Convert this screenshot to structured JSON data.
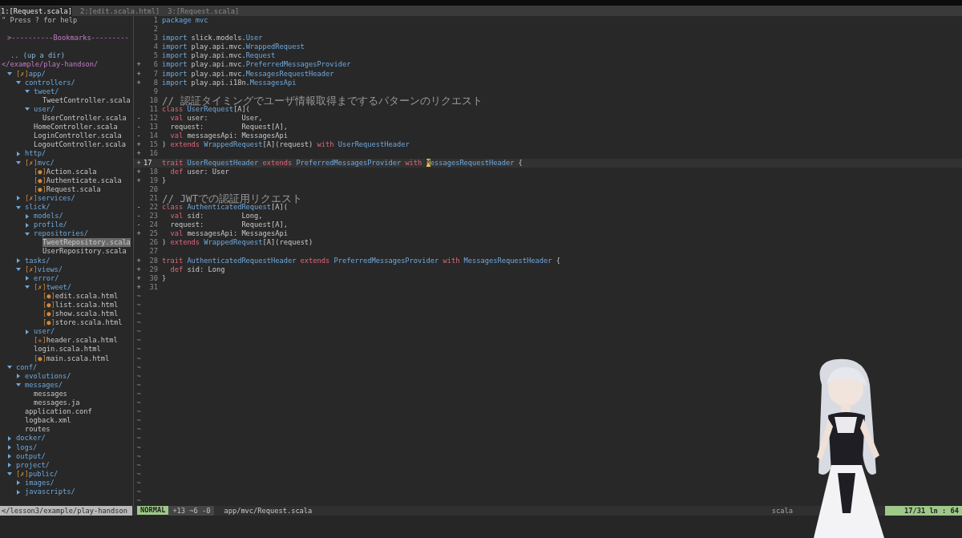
{
  "tabs": [
    {
      "label": "1:[Request.scala]",
      "selected": true
    },
    {
      "label": "2:[edit.scala.html]",
      "selected": false
    },
    {
      "label": "3:[Request.scala]",
      "selected": false
    }
  ],
  "tree": {
    "help": "\" Press ? for help",
    "bookmarks": ">----------Bookmarks---------",
    "up_dir": ".. (up a dir)",
    "root": "</example/play-handson/",
    "items": [
      {
        "name": "app/",
        "flag": "[✗]",
        "kind": "dir",
        "expanded": true,
        "selected": false,
        "children": [
          {
            "name": "controllers/",
            "kind": "dir",
            "expanded": true,
            "selected": false,
            "children": [
              {
                "name": "tweet/",
                "kind": "dir",
                "expanded": true,
                "selected": false,
                "children": [
                  {
                    "name": "TweetController.scala",
                    "kind": "file",
                    "selected": false
                  }
                ]
              },
              {
                "name": "user/",
                "kind": "dir",
                "expanded": true,
                "selected": false,
                "children": [
                  {
                    "name": "UserController.scala",
                    "kind": "file",
                    "selected": false
                  }
                ]
              },
              {
                "name": "HomeController.scala",
                "kind": "file",
                "selected": false
              },
              {
                "name": "LoginController.scala",
                "kind": "file",
                "selected": false
              },
              {
                "name": "LogoutController.scala",
                "kind": "file",
                "selected": false
              }
            ]
          },
          {
            "name": "http/",
            "kind": "dir",
            "expanded": false,
            "selected": false
          },
          {
            "name": "mvc/",
            "flag": "[✗]",
            "kind": "dir",
            "expanded": true,
            "selected": false,
            "children": [
              {
                "name": "Action.scala",
                "flag": "[●]",
                "kind": "file",
                "selected": false
              },
              {
                "name": "Authenticate.scala",
                "flag": "[●]",
                "kind": "file",
                "selected": false
              },
              {
                "name": "Request.scala",
                "flag": "[●]",
                "kind": "file",
                "selected": false
              }
            ]
          },
          {
            "name": "services/",
            "flag": "[✗]",
            "kind": "dir",
            "expanded": false,
            "selected": false
          },
          {
            "name": "slick/",
            "kind": "dir",
            "expanded": true,
            "selected": false,
            "children": [
              {
                "name": "models/",
                "kind": "dir",
                "expanded": false,
                "selected": false
              },
              {
                "name": "profile/",
                "kind": "dir",
                "expanded": false,
                "selected": false
              },
              {
                "name": "repositories/",
                "kind": "dir",
                "expanded": true,
                "selected": false,
                "children": [
                  {
                    "name": "TweetRepository.scala",
                    "kind": "file",
                    "selected": true
                  },
                  {
                    "name": "UserRepository.scala",
                    "kind": "file",
                    "selected": false
                  }
                ]
              }
            ]
          },
          {
            "name": "tasks/",
            "kind": "dir",
            "expanded": false,
            "selected": false
          },
          {
            "name": "views/",
            "flag": "[✗]",
            "kind": "dir",
            "expanded": true,
            "selected": false,
            "children": [
              {
                "name": "error/",
                "kind": "dir",
                "expanded": false,
                "selected": false
              },
              {
                "name": "tweet/",
                "flag": "[✗]",
                "kind": "dir",
                "expanded": true,
                "selected": false,
                "children": [
                  {
                    "name": "edit.scala.html",
                    "flag": "[●]",
                    "kind": "file",
                    "selected": false
                  },
                  {
                    "name": "list.scala.html",
                    "flag": "[●]",
                    "kind": "file",
                    "selected": false
                  },
                  {
                    "name": "show.scala.html",
                    "flag": "[●]",
                    "kind": "file",
                    "selected": false
                  },
                  {
                    "name": "store.scala.html",
                    "flag": "[●]",
                    "kind": "file",
                    "selected": false
                  }
                ]
              },
              {
                "name": "user/",
                "kind": "dir",
                "expanded": false,
                "selected": false
              },
              {
                "name": "header.scala.html",
                "flag": "[✭]",
                "kind": "file",
                "selected": false
              },
              {
                "name": "login.scala.html",
                "kind": "file",
                "selected": false
              },
              {
                "name": "main.scala.html",
                "flag": "[●]",
                "kind": "file",
                "selected": false
              }
            ]
          }
        ]
      },
      {
        "name": "conf/",
        "kind": "dir",
        "expanded": true,
        "selected": false,
        "children": [
          {
            "name": "evolutions/",
            "kind": "dir",
            "expanded": false,
            "selected": false
          },
          {
            "name": "messages/",
            "kind": "dir",
            "expanded": true,
            "selected": false,
            "children": [
              {
                "name": "messages",
                "kind": "file",
                "selected": false
              },
              {
                "name": "messages.ja",
                "kind": "file",
                "selected": false
              }
            ]
          },
          {
            "name": "application.conf",
            "kind": "file",
            "selected": false
          },
          {
            "name": "logback.xml",
            "kind": "file",
            "selected": false
          },
          {
            "name": "routes",
            "kind": "file",
            "selected": false
          }
        ]
      },
      {
        "name": "docker/",
        "kind": "dir",
        "expanded": false,
        "selected": false
      },
      {
        "name": "logs/",
        "kind": "dir",
        "expanded": false,
        "selected": false
      },
      {
        "name": "output/",
        "kind": "dir",
        "expanded": false,
        "selected": false
      },
      {
        "name": "project/",
        "kind": "dir",
        "expanded": false,
        "selected": false
      },
      {
        "name": "public/",
        "flag": "[✗]",
        "kind": "dir",
        "expanded": true,
        "selected": false,
        "children": [
          {
            "name": "images/",
            "kind": "dir",
            "expanded": false,
            "selected": false
          },
          {
            "name": "javascripts/",
            "kind": "dir",
            "expanded": false,
            "selected": false
          }
        ]
      }
    ]
  },
  "code": {
    "lines": [
      {
        "number": "1",
        "current": false,
        "tokens": [
          {
            "text": "package mvc",
            "kind": "type"
          }
        ]
      },
      {
        "number": "2",
        "current": false
      },
      {
        "number": "3",
        "current": false,
        "tokens": [
          {
            "text": "import",
            "kind": "type"
          },
          {
            "text": " slick.models.",
            "kind": "plain"
          },
          {
            "text": "User",
            "kind": "type"
          }
        ]
      },
      {
        "number": "4",
        "current": false,
        "tokens": [
          {
            "text": "import",
            "kind": "type"
          },
          {
            "text": " play.api.mvc.",
            "kind": "plain"
          },
          {
            "text": "WrappedRequest",
            "kind": "type"
          }
        ]
      },
      {
        "number": "5",
        "current": false,
        "tokens": [
          {
            "text": "import",
            "kind": "type"
          },
          {
            "text": " play.api.mvc.",
            "kind": "plain"
          },
          {
            "text": "Request",
            "kind": "type"
          }
        ]
      },
      {
        "number": "6",
        "sign": "+",
        "current": false,
        "tokens": [
          {
            "text": "import",
            "kind": "type"
          },
          {
            "text": " play.api.mvc.",
            "kind": "plain"
          },
          {
            "text": "PreferredMessagesProvider",
            "kind": "type"
          }
        ]
      },
      {
        "number": "7",
        "sign": "+",
        "current": false,
        "tokens": [
          {
            "text": "import",
            "kind": "type"
          },
          {
            "text": " play.api.mvc.",
            "kind": "plain"
          },
          {
            "text": "MessagesRequestHeader",
            "kind": "type"
          }
        ]
      },
      {
        "number": "8",
        "sign": "+",
        "current": false,
        "tokens": [
          {
            "text": "import",
            "kind": "type"
          },
          {
            "text": " play.api.i18n.",
            "kind": "plain"
          },
          {
            "text": "MessagesApi",
            "kind": "type"
          }
        ]
      },
      {
        "number": "9",
        "current": false
      },
      {
        "number": "10",
        "current": false,
        "tokens": [
          {
            "text": "// 認証タイミングでユーザ情報取得までするパターンのリクエスト",
            "kind": "comment"
          }
        ]
      },
      {
        "number": "11",
        "current": false,
        "tokens": [
          {
            "text": "class",
            "kind": "keyword"
          },
          {
            "text": " UserRequest",
            "kind": "type"
          },
          {
            "text": "[A](",
            "kind": "plain"
          }
        ]
      },
      {
        "number": "12",
        "sign": "-",
        "current": false,
        "tokens": [
          {
            "text": "  val",
            "kind": "keyword"
          },
          {
            "text": " user:        User,",
            "kind": "plain"
          }
        ]
      },
      {
        "number": "13",
        "sign": "-",
        "current": false,
        "tokens": [
          {
            "text": "  request:         Request[A],",
            "kind": "plain"
          }
        ]
      },
      {
        "number": "14",
        "sign": "-",
        "current": false,
        "tokens": [
          {
            "text": "  val",
            "kind": "keyword"
          },
          {
            "text": " messagesApi: MessagesApi",
            "kind": "plain"
          }
        ]
      },
      {
        "number": "15",
        "sign": "+",
        "current": false,
        "tokens": [
          {
            "text": ") ",
            "kind": "plain"
          },
          {
            "text": "extends",
            "kind": "keyword"
          },
          {
            "text": " WrappedRequest",
            "kind": "type"
          },
          {
            "text": "[A](request) ",
            "kind": "plain"
          },
          {
            "text": "with",
            "kind": "keyword"
          },
          {
            "text": " UserRequestHeader",
            "kind": "type"
          }
        ]
      },
      {
        "number": "16",
        "sign": "+",
        "current": false
      },
      {
        "number": "17",
        "sign": "+",
        "current": true,
        "tokens": [
          {
            "text": "trait",
            "kind": "keyword"
          },
          {
            "text": " UserRequestHeader",
            "kind": "type"
          },
          {
            "text": " extends",
            "kind": "keyword"
          },
          {
            "text": " PreferredMessagesProvider",
            "kind": "type"
          },
          {
            "text": " with ",
            "kind": "keyword"
          },
          {
            "text": "M",
            "kind": "cursor"
          },
          {
            "text": "essagesRequestHeader",
            "kind": "type"
          },
          {
            "text": " {",
            "kind": "plain"
          }
        ]
      },
      {
        "number": "18",
        "sign": "+",
        "current": false,
        "tokens": [
          {
            "text": "  def",
            "kind": "keyword"
          },
          {
            "text": " user: User",
            "kind": "plain"
          }
        ]
      },
      {
        "number": "19",
        "sign": "+",
        "current": false,
        "tokens": [
          {
            "text": "}",
            "kind": "plain"
          }
        ]
      },
      {
        "number": "20",
        "current": false
      },
      {
        "number": "21",
        "current": false,
        "tokens": [
          {
            "text": "// JWTでの認証用リクエスト",
            "kind": "comment"
          }
        ]
      },
      {
        "number": "22",
        "sign": "-",
        "current": false,
        "tokens": [
          {
            "text": "class",
            "kind": "keyword"
          },
          {
            "text": " AuthenticatedRequest",
            "kind": "type"
          },
          {
            "text": "[A](",
            "kind": "plain"
          }
        ]
      },
      {
        "number": "23",
        "sign": "-",
        "current": false,
        "tokens": [
          {
            "text": "  val",
            "kind": "keyword"
          },
          {
            "text": " sid:         Long,",
            "kind": "plain"
          }
        ]
      },
      {
        "number": "24",
        "sign": "-",
        "current": false,
        "tokens": [
          {
            "text": "  request:         Request[A],",
            "kind": "plain"
          }
        ]
      },
      {
        "number": "25",
        "sign": "+",
        "current": false,
        "tokens": [
          {
            "text": "  val",
            "kind": "keyword"
          },
          {
            "text": " messagesApi: MessagesApi",
            "kind": "plain"
          }
        ]
      },
      {
        "number": "26",
        "current": false,
        "tokens": [
          {
            "text": ") ",
            "kind": "plain"
          },
          {
            "text": "extends",
            "kind": "keyword"
          },
          {
            "text": " WrappedRequest",
            "kind": "type"
          },
          {
            "text": "[A](request)",
            "kind": "plain"
          }
        ]
      },
      {
        "number": "27",
        "current": false
      },
      {
        "number": "28",
        "sign": "+",
        "current": false,
        "tokens": [
          {
            "text": "trait",
            "kind": "keyword"
          },
          {
            "text": " AuthenticatedRequestHeader",
            "kind": "type"
          },
          {
            "text": " extends",
            "kind": "keyword"
          },
          {
            "text": " PreferredMessagesProvider",
            "kind": "type"
          },
          {
            "text": " with",
            "kind": "keyword"
          },
          {
            "text": " MessagesRequestHeader",
            "kind": "type"
          },
          {
            "text": " {",
            "kind": "plain"
          }
        ]
      },
      {
        "number": "29",
        "sign": "+",
        "current": false,
        "tokens": [
          {
            "text": "  def",
            "kind": "keyword"
          },
          {
            "text": " sid: Long",
            "kind": "plain"
          }
        ]
      },
      {
        "number": "30",
        "sign": "+",
        "current": false,
        "tokens": [
          {
            "text": "}",
            "kind": "plain"
          }
        ]
      },
      {
        "number": "31",
        "sign": "+",
        "current": false
      }
    ],
    "filler": [
      "~",
      "~",
      "~",
      "~",
      "~",
      "~",
      "~",
      "~",
      "~",
      "~",
      "~",
      "~",
      "~",
      "~",
      "~",
      "~",
      "~",
      "~",
      "~",
      "~",
      "~",
      "~",
      "~",
      "~"
    ]
  },
  "status_bar": {
    "tree_path": "</lesson3/example/play-handson",
    "mode": "NORMAL",
    "diff": "+13 ~6 -0",
    "file": "app/mvc/Request.scala",
    "filetype": "scala",
    "position": "17/31 ln : 64"
  }
}
